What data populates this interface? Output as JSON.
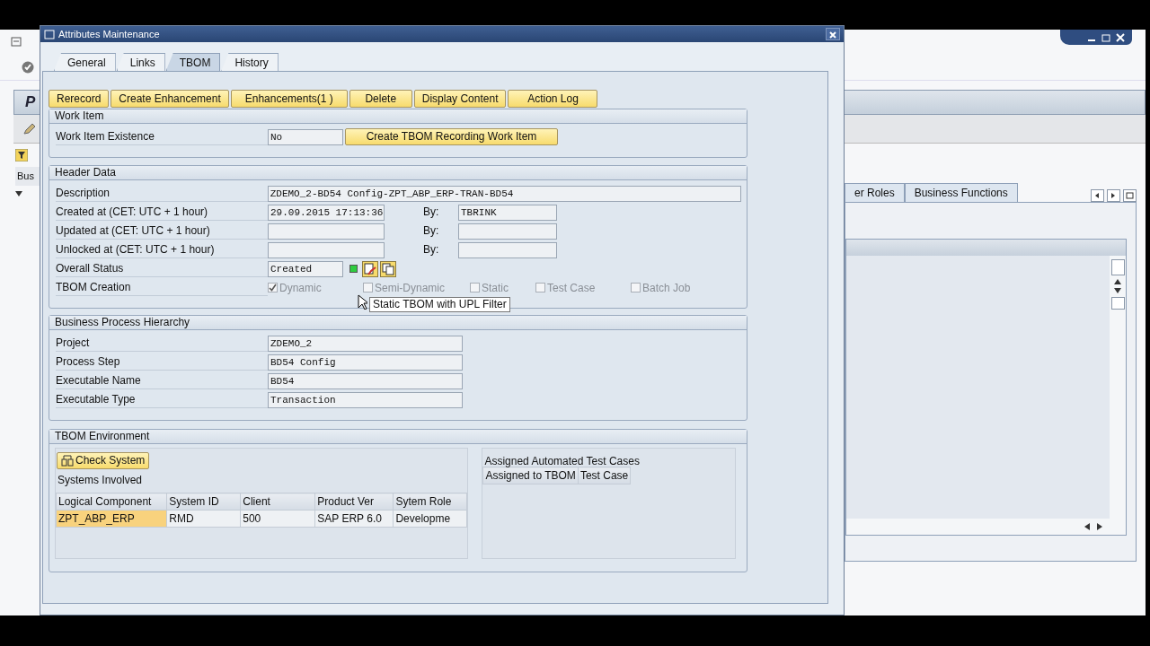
{
  "background": {
    "header_text": "P",
    "column_text": "Bus",
    "tabs": [
      {
        "label": "er Roles",
        "selected": false
      },
      {
        "label": "Business Functions",
        "selected": false
      }
    ]
  },
  "dialog": {
    "title": "Attributes Maintenance"
  },
  "tabs": [
    {
      "label": "General",
      "selected": false
    },
    {
      "label": "Links",
      "selected": false
    },
    {
      "label": "TBOM",
      "selected": true
    },
    {
      "label": "History",
      "selected": false
    }
  ],
  "toolbar": [
    "Rerecord",
    "Create Enhancement",
    "Enhancements(1 )",
    "Delete",
    "Display Content",
    "Action Log"
  ],
  "work_item": {
    "title": "Work Item",
    "label": "Work Item Existence",
    "value": "No",
    "button": "Create TBOM Recording Work Item"
  },
  "header_data": {
    "title": "Header Data",
    "description": {
      "label": "Description",
      "value": "ZDEMO_2-BD54 Config-ZPT_ABP_ERP-TRAN-BD54"
    },
    "timestamps": [
      {
        "label": "Created at (CET: UTC +  1 hour)",
        "value": "29.09.2015 17:13:36",
        "by_label": "By:",
        "by_value": "TBRINK"
      },
      {
        "label": "Updated at (CET: UTC +  1 hour)",
        "by_label": "By:"
      },
      {
        "label": "Unlocked at (CET: UTC +  1 hour)",
        "by_label": "By:"
      }
    ],
    "status": {
      "label": "Overall Status",
      "value": "Created",
      "color": "#2ecc40"
    },
    "creation": {
      "label": "TBOM Creation",
      "disabled": true,
      "options": [
        {
          "label": "Dynamic",
          "checked": true
        },
        {
          "label": "Semi-Dynamic",
          "checked": false
        },
        {
          "label": "Static",
          "checked": false
        },
        {
          "label": "Test Case",
          "checked": false
        },
        {
          "label": "Batch Job",
          "checked": false
        }
      ]
    },
    "tooltip": "Static TBOM with UPL Filter"
  },
  "hierarchy": {
    "title": "Business Process Hierarchy",
    "fields": [
      {
        "label": "Project",
        "value": "ZDEMO_2"
      },
      {
        "label": "Process Step",
        "value": "BD54 Config"
      },
      {
        "label": "Executable Name",
        "value": "BD54"
      },
      {
        "label": "Executable Type",
        "value": "Transaction"
      }
    ]
  },
  "environment": {
    "title": "TBOM Environment",
    "check_button": "Check System",
    "systems_title": "Systems Involved",
    "columns": [
      {
        "label": "Logical Component",
        "key": true
      },
      {
        "label": "System ID",
        "key": false
      },
      {
        "label": "Client",
        "key": false
      },
      {
        "label": "Product Ver",
        "key": false
      },
      {
        "label": "Sytem Role",
        "key": false
      }
    ],
    "rows": [
      [
        "ZPT_ABP_ERP",
        "RMD",
        "500",
        "SAP ERP 6.0",
        "Developme"
      ]
    ],
    "tests_title": "Assigned Automated Test Cases",
    "test_columns": [
      "Assigned to TBOM",
      "Test Case"
    ]
  }
}
